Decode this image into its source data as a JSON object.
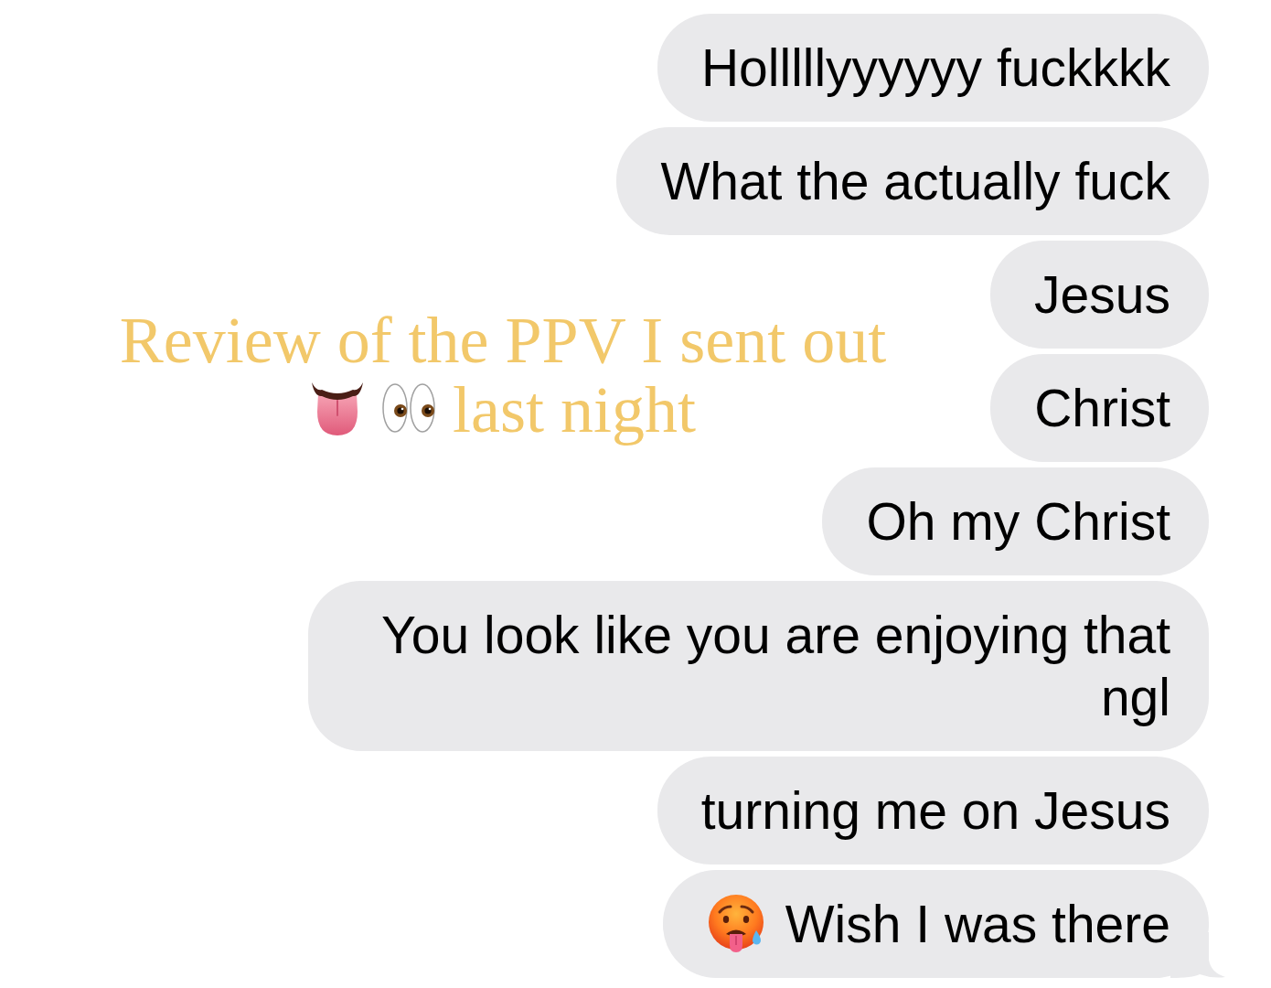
{
  "messages": [
    {
      "text": "Holllllyyyyyy fuckkkk",
      "emoji": false,
      "tail": false
    },
    {
      "text": "What the actually fuck",
      "emoji": false,
      "tail": false
    },
    {
      "text": "Jesus",
      "emoji": false,
      "tail": false
    },
    {
      "text": "Christ",
      "emoji": false,
      "tail": false
    },
    {
      "text": "Oh my Christ",
      "emoji": false,
      "tail": false
    },
    {
      "text": "You look like you are enjoying that ngl",
      "emoji": false,
      "tail": false
    },
    {
      "text": "turning me on Jesus",
      "emoji": false,
      "tail": false
    },
    {
      "text": "Wish I was there",
      "emoji": true,
      "tail": true
    }
  ],
  "caption": {
    "lines": [
      "Review of the PPV I sent out",
      "last night"
    ]
  }
}
